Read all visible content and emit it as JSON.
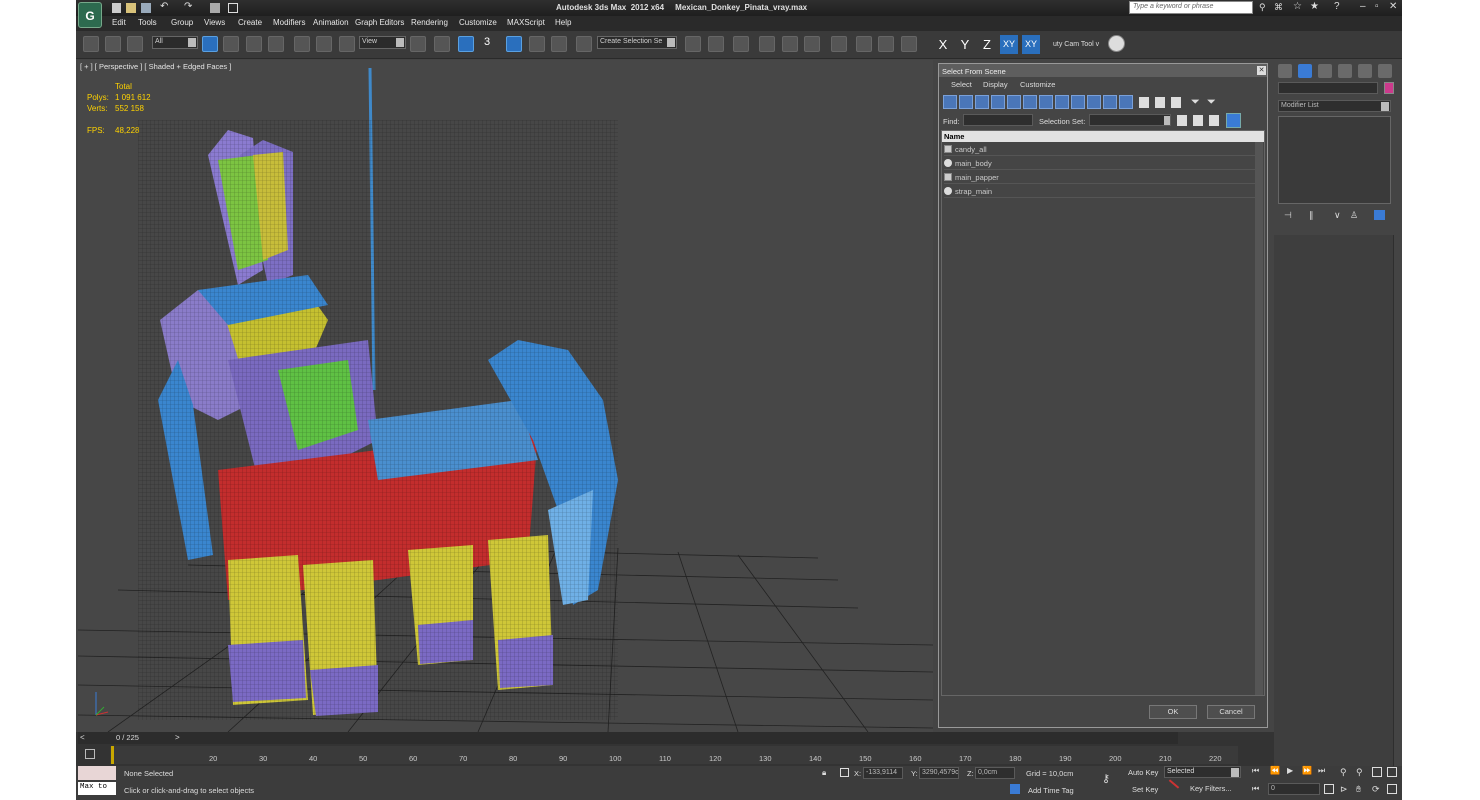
{
  "window": {
    "title": "Autodesk 3ds Max  2012 x64     Mexican_Donkey_Pinata_vray.max",
    "search_placeholder": "Type a keyword or phrase"
  },
  "menu": [
    "Edit",
    "Tools",
    "Group",
    "Views",
    "Create",
    "Modifiers",
    "Animation",
    "Graph Editors",
    "Rendering",
    "Customize",
    "MAXScript",
    "Help"
  ],
  "toolbar": {
    "filter_value": "All",
    "refcoord_value": "View",
    "snap_label": "3",
    "selection_set_value": "Create Selection Se",
    "axis_x": "X",
    "axis_y": "Y",
    "axis_z": "Z",
    "axis_xy": "XY",
    "axis_xy2": "XY",
    "beauty_cam": "uty Cam Tool v"
  },
  "viewport": {
    "label": "[ + ] [ Perspective ] [ Shaded + Edged Faces ]",
    "stats": {
      "total_label": "Total",
      "polys_label": "Polys:",
      "polys_value": "1 091 612",
      "verts_label": "Verts:",
      "verts_value": "552 158",
      "fps_label": "FPS:",
      "fps_value": "48,228"
    }
  },
  "dialog": {
    "title": "Select From Scene",
    "menu": [
      "Select",
      "Display",
      "Customize"
    ],
    "find_label": "Find:",
    "selset_label": "Selection Set:",
    "column_name": "Name",
    "objects": [
      "candy_all",
      "main_body",
      "main_papper",
      "strap_main"
    ],
    "ok": "OK",
    "cancel": "Cancel"
  },
  "command_panel": {
    "modifier_list": "Modifier List",
    "color_swatch": "#cc3a8c"
  },
  "timeline": {
    "frame_counter": "0 / 225",
    "ticks": [
      "20",
      "30",
      "40",
      "50",
      "60",
      "70",
      "80",
      "90",
      "100",
      "110",
      "120",
      "130",
      "140",
      "150",
      "160",
      "170",
      "180",
      "190",
      "200",
      "210",
      "220"
    ]
  },
  "status": {
    "maxscript": "Max to",
    "selection": "None Selected",
    "prompt": "Click or click-and-drag to select objects",
    "x_label": "X:",
    "x_value": "-133,9114",
    "y_label": "Y:",
    "y_value": "3290,4579c",
    "z_label": "Z:",
    "z_value": "0,0cm",
    "grid": "Grid = 10,0cm",
    "add_time_tag": "Add Time Tag",
    "auto_key": "Auto Key",
    "set_key": "Set Key",
    "selected": "Selected",
    "key_filters": "Key Filters...",
    "frame_value": "0"
  }
}
